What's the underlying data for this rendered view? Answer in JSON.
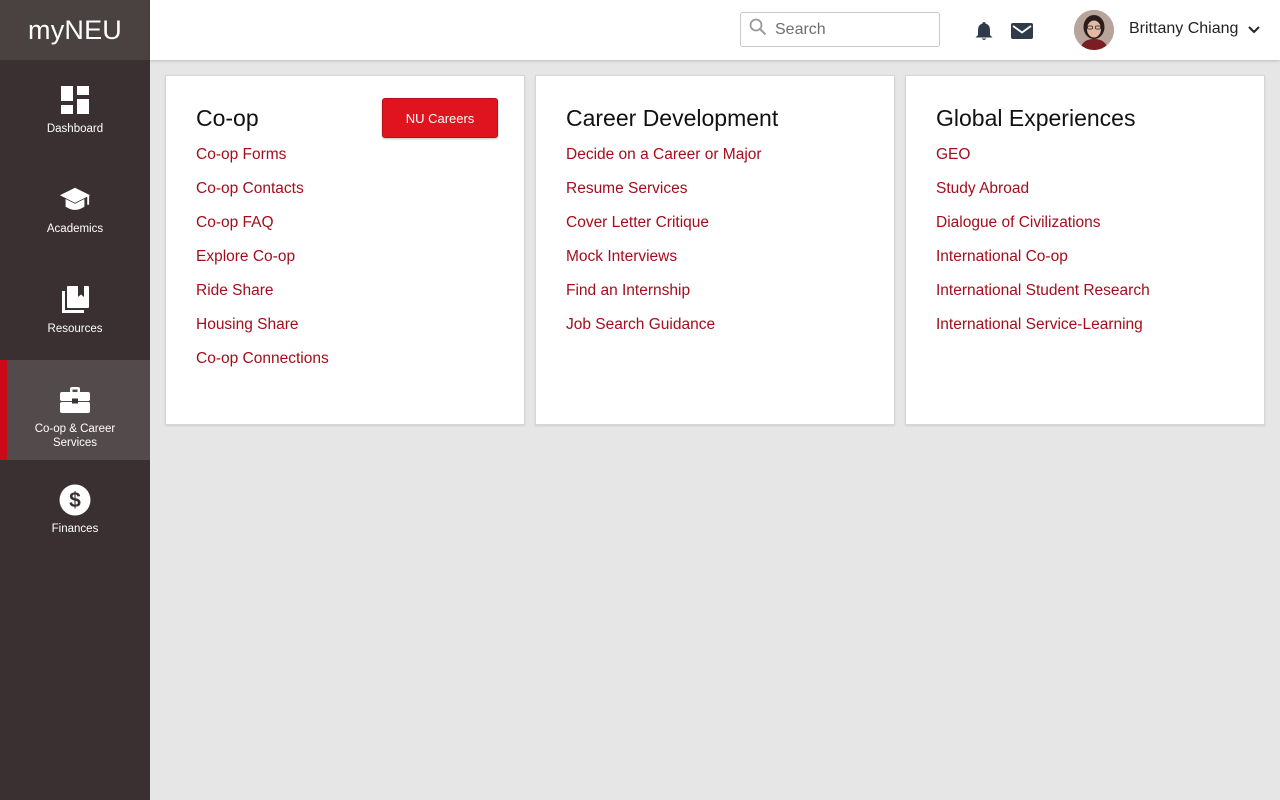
{
  "app": {
    "logo": "myNEU"
  },
  "sidebar": {
    "items": [
      {
        "label": "Dashboard",
        "icon": "dashboard-icon",
        "active": false
      },
      {
        "label": "Academics",
        "icon": "graduation-cap-icon",
        "active": false
      },
      {
        "label": "Resources",
        "icon": "books-icon",
        "active": false
      },
      {
        "label": "Co-op & Career Services",
        "icon": "briefcase-icon",
        "active": true
      },
      {
        "label": "Finances",
        "icon": "dollar-icon",
        "active": false
      }
    ]
  },
  "header": {
    "search": {
      "placeholder": "Search",
      "value": ""
    },
    "user": {
      "name": "Brittany Chiang"
    },
    "icons": [
      "bell-icon",
      "mail-icon",
      "avatar",
      "chevron-down-icon"
    ]
  },
  "colors": {
    "accent": "#cc0a17",
    "link": "#a50d1c",
    "sidebar_bg": "#3a3031",
    "button": "#e0141f"
  },
  "cards": {
    "coop": {
      "title": "Co-op",
      "button": "NU Careers",
      "links": [
        "Co-op Forms",
        "Co-op Contacts",
        "Co-op FAQ",
        "Explore Co-op",
        "Ride Share",
        "Housing Share",
        "Co-op Connections"
      ]
    },
    "career": {
      "title": "Career Development",
      "links": [
        "Decide on a Career or Major",
        "Resume Services",
        "Cover Letter Critique",
        "Mock Interviews",
        "Find an Internship",
        "Job Search Guidance"
      ]
    },
    "global": {
      "title": "Global Experiences",
      "links": [
        "GEO",
        "Study Abroad",
        "Dialogue of Civilizations",
        "International Co-op",
        "International Student Research",
        "International Service-Learning"
      ]
    }
  }
}
